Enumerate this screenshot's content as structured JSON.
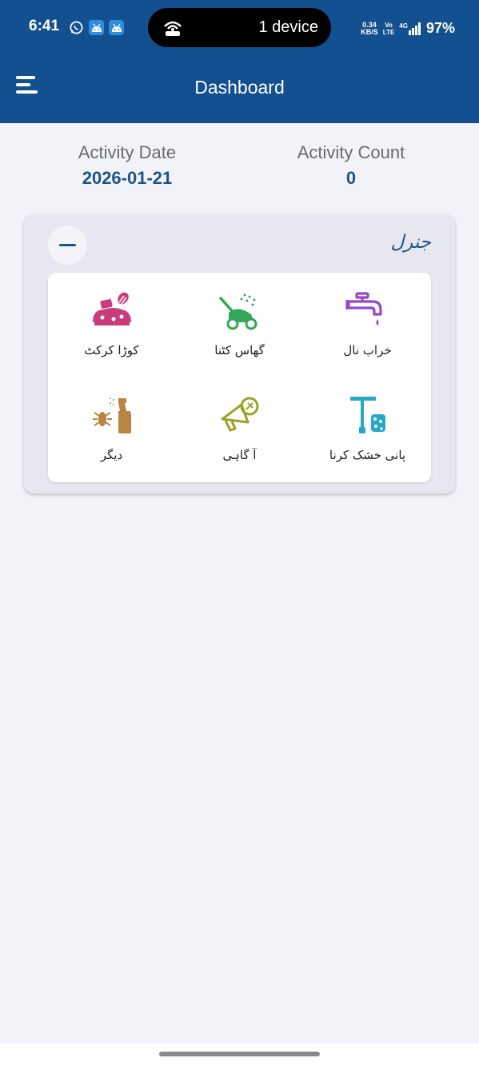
{
  "status_bar": {
    "time": "6:41",
    "hotspot_label": "1 device",
    "network_speed_value": "0.34",
    "network_speed_unit": "KB/S",
    "volte_top": "Vo",
    "volte_bottom": "LTE",
    "network_type": "4G",
    "battery": "97%"
  },
  "app_bar": {
    "title": "Dashboard",
    "menu_icon": "hamburger-menu-icon"
  },
  "summary": {
    "activity_date_label": "Activity Date",
    "activity_date_value": "2026-01-21",
    "activity_count_label": "Activity Count",
    "activity_count_value": "0"
  },
  "card": {
    "title": "جنرل",
    "toggle_icon": "minus-icon",
    "items": [
      {
        "label": "خراب نال",
        "icon": "faucet-icon",
        "color": "#9b45c9"
      },
      {
        "label": "گھاس کٹنا",
        "icon": "lawn-mower-icon",
        "color": "#33a856"
      },
      {
        "label": "کوڑا کرکٹ",
        "icon": "garbage-icon",
        "color": "#c93b7a"
      },
      {
        "label": "پانی خشک کرنا",
        "icon": "squeegee-icon",
        "color": "#26a9c7"
      },
      {
        "label": "آ گاہی",
        "icon": "megaphone-icon",
        "color": "#9aa324"
      },
      {
        "label": "دیگر",
        "icon": "insect-spray-icon",
        "color": "#b98543"
      }
    ]
  },
  "colors": {
    "app_bar": "#125090",
    "accent_text": "#1e5385",
    "background": "#f2f3f9"
  }
}
